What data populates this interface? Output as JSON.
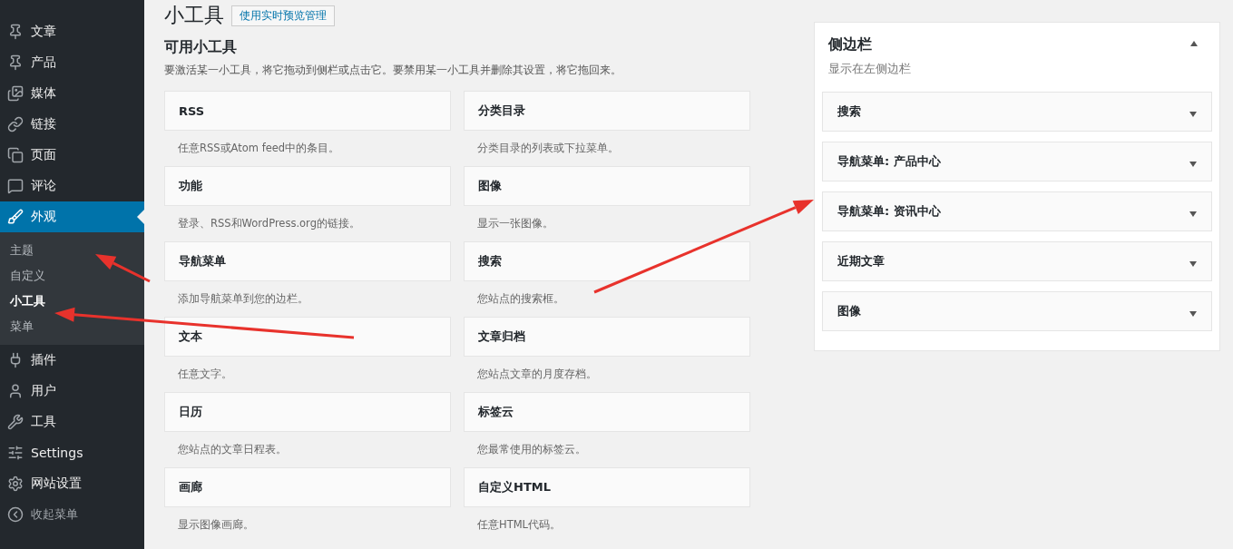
{
  "menu": [
    {
      "label": "文章",
      "selected": false
    },
    {
      "label": "产品",
      "selected": false
    },
    {
      "label": "媒体",
      "selected": false
    },
    {
      "label": "链接",
      "selected": false
    },
    {
      "label": "页面",
      "selected": false
    },
    {
      "label": "评论",
      "selected": false
    },
    {
      "label": "外观",
      "selected": true,
      "submenu": [
        {
          "label": "主题",
          "selected": false
        },
        {
          "label": "自定义",
          "selected": false
        },
        {
          "label": "小工具",
          "selected": true
        },
        {
          "label": "菜单",
          "selected": false
        }
      ]
    },
    {
      "label": "插件",
      "selected": false
    },
    {
      "label": "用户",
      "selected": false
    },
    {
      "label": "工具",
      "selected": false
    },
    {
      "label": "Settings",
      "selected": false
    },
    {
      "label": "网站设置",
      "selected": false
    }
  ],
  "collapse_menu": "收起菜单",
  "page_title": "小工具",
  "live_preview_button": "使用实时预览管理",
  "available": {
    "title": "可用小工具",
    "description": "要激活某一小工具，将它拖动到侧栏或点击它。要禁用某一小工具并删除其设置，将它拖回来。",
    "widgets": [
      {
        "title": "RSS",
        "description": "任意RSS或Atom feed中的条目。"
      },
      {
        "title": "分类目录",
        "description": "分类目录的列表或下拉菜单。"
      },
      {
        "title": "功能",
        "description": "登录、RSS和WordPress.org的链接。"
      },
      {
        "title": "图像",
        "description": "显示一张图像。"
      },
      {
        "title": "导航菜单",
        "description": "添加导航菜单到您的边栏。"
      },
      {
        "title": "搜索",
        "description": "您站点的搜索框。"
      },
      {
        "title": "文本",
        "description": "任意文字。"
      },
      {
        "title": "文章归档",
        "description": "您站点文章的月度存档。"
      },
      {
        "title": "日历",
        "description": "您站点的文章日程表。"
      },
      {
        "title": "标签云",
        "description": "您最常使用的标签云。"
      },
      {
        "title": "画廊",
        "description": "显示图像画廊。"
      },
      {
        "title": "自定义HTML",
        "description": "任意HTML代码。"
      }
    ]
  },
  "sidebar_area": {
    "title": "侧边栏",
    "description": "显示在左侧边栏",
    "expanded": true,
    "widgets": [
      {
        "title": "搜索",
        "expanded": false
      },
      {
        "title": "导航菜单: 产品中心",
        "expanded": false
      },
      {
        "title": "导航菜单: 资讯中心",
        "expanded": false
      },
      {
        "title": "近期文章",
        "expanded": false
      },
      {
        "title": "图像",
        "expanded": false
      }
    ]
  }
}
